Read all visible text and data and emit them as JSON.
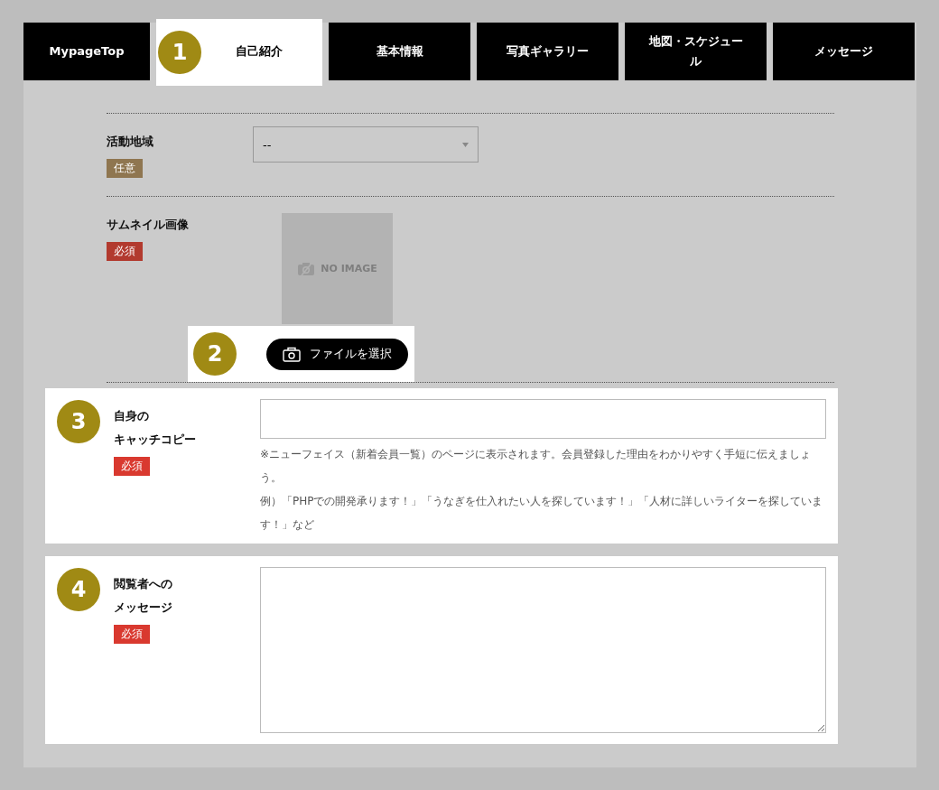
{
  "tabs": [
    {
      "label": "MypageTop",
      "selected": false
    },
    {
      "label": "自己紹介",
      "selected": true,
      "callout": "1"
    },
    {
      "label": "基本情報",
      "selected": false
    },
    {
      "label": "写真ギャラリー",
      "selected": false
    },
    {
      "label": "地図・スケジュール",
      "selected": false
    },
    {
      "label": "メッセージ",
      "selected": false
    }
  ],
  "fields": [
    {
      "kind": "select",
      "label": [
        "活動地域"
      ],
      "tag": "任意",
      "required": false,
      "value": "--"
    },
    {
      "kind": "image",
      "label": [
        "サムネイル画像"
      ],
      "tag": "必須",
      "required": true,
      "image_text": "NO IMAGE",
      "button": "ファイルを選択",
      "callout": "2"
    },
    {
      "kind": "text",
      "label": [
        "自身の",
        "キャッチコピー"
      ],
      "tag": "必須",
      "required": true,
      "callout": "3",
      "notes": [
        "※ニューフェイス（新着会員一覧）のページに表示されます。会員登録した理由をわかりやすく手短に伝えましょう。",
        "例）「PHPでの開発承ります！」「うなぎを仕入れたい人を探しています！」「人材に詳しいライターを探しています！」など"
      ]
    },
    {
      "kind": "textarea",
      "label": [
        "閲覧者への",
        "メッセージ"
      ],
      "tag": "必須",
      "required": true,
      "callout": "4"
    }
  ]
}
